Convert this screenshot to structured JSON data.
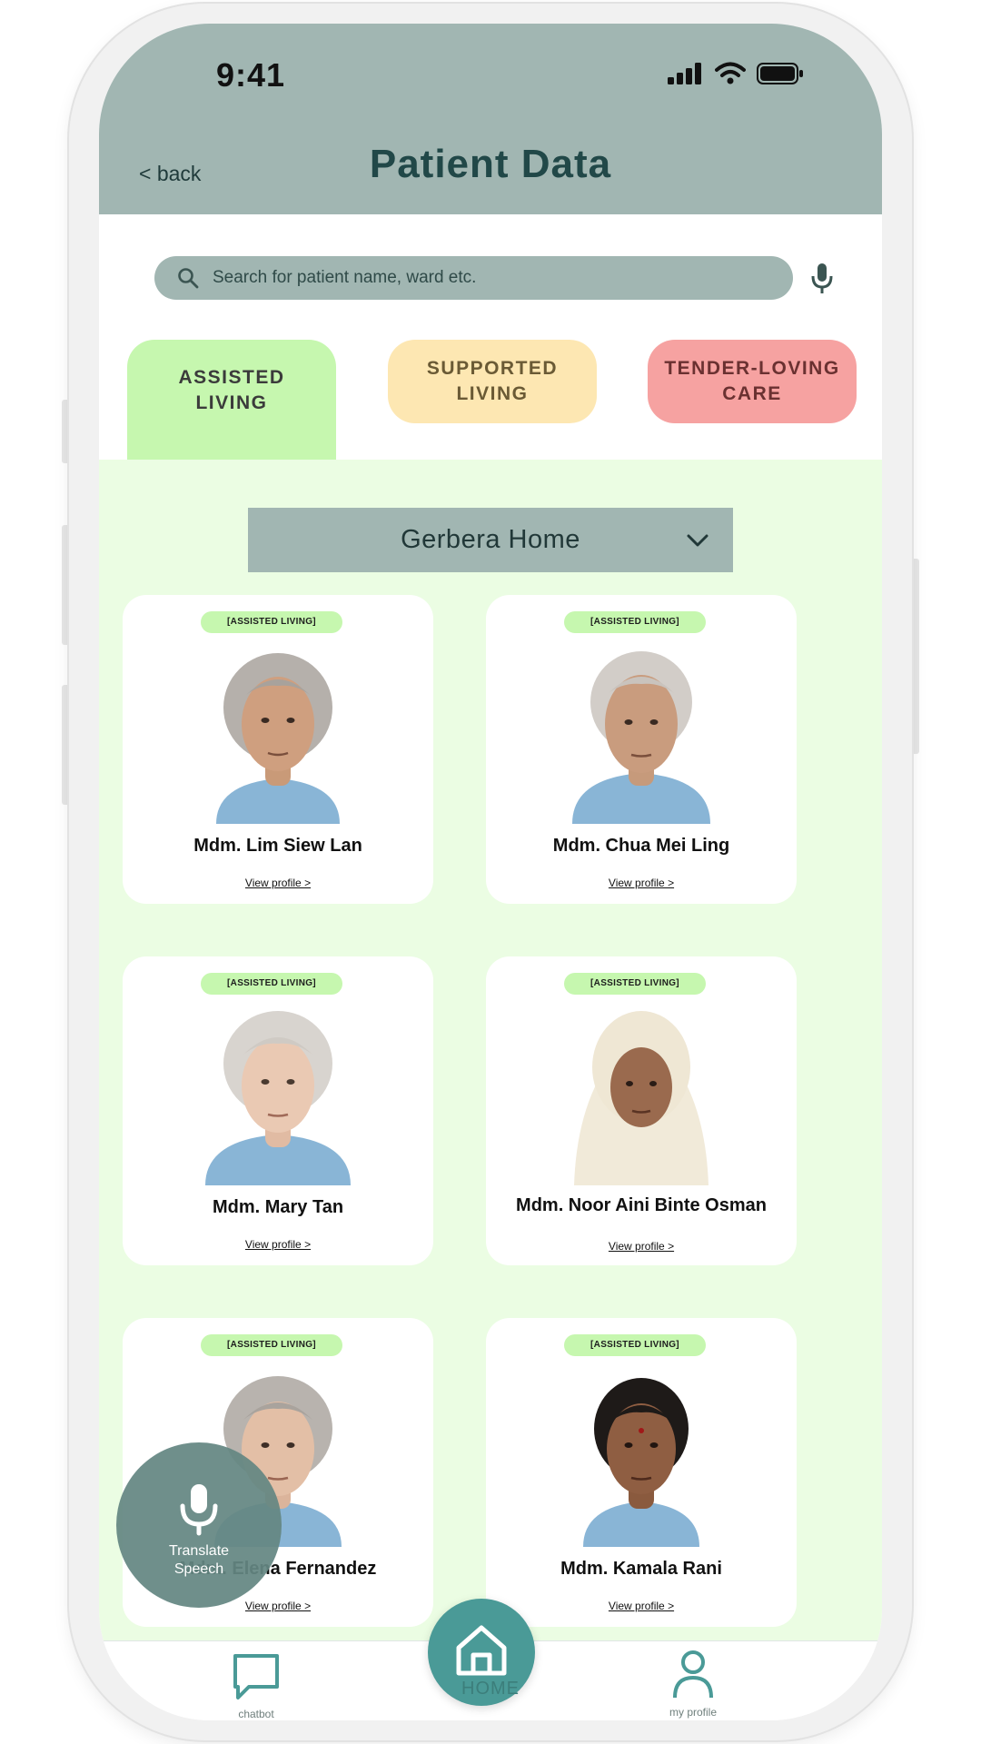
{
  "status_bar": {
    "time": "9:41"
  },
  "header": {
    "back_label": "< back",
    "title": "Patient Data"
  },
  "search": {
    "placeholder": "Search for patient name, ward etc."
  },
  "tabs": [
    {
      "line1": "ASSISTED",
      "line2": "LIVING",
      "color": "#c6f7af",
      "selected": true
    },
    {
      "line1": "SUPPORTED",
      "line2": "LIVING",
      "color": "#fde7b2"
    },
    {
      "line1": "TENDER-LOVING",
      "line2": "CARE",
      "color": "#f6a2a1"
    }
  ],
  "home_selector": {
    "value": "Gerbera Home"
  },
  "patients": [
    {
      "badge": "[ASSISTED LIVING]",
      "name": "Mdm. Lim Siew Lan",
      "link": "View profile >"
    },
    {
      "badge": "[ASSISTED LIVING]",
      "name": "Mdm. Chua Mei Ling",
      "link": "View profile >"
    },
    {
      "badge": "[ASSISTED LIVING]",
      "name": "Mdm. Mary Tan",
      "link": "View profile >"
    },
    {
      "badge": "[ASSISTED LIVING]",
      "name": "Mdm. Noor Aini Binte Osman",
      "link": "View profile >"
    },
    {
      "badge": "[ASSISTED LIVING]",
      "name": "Mdm. Elena Fernandez",
      "link": "View profile >"
    },
    {
      "badge": "[ASSISTED LIVING]",
      "name": "Mdm. Kamala Rani",
      "link": "View profile >"
    }
  ],
  "translate": {
    "line1": "Translate",
    "line2": "Speech"
  },
  "nav": {
    "chatbot": "chatbot",
    "home": "HOME",
    "profile": "my profile"
  },
  "colors": {
    "header": "#a1b6b2",
    "accent": "#4a9a97",
    "content_bg": "#ebfde3"
  }
}
